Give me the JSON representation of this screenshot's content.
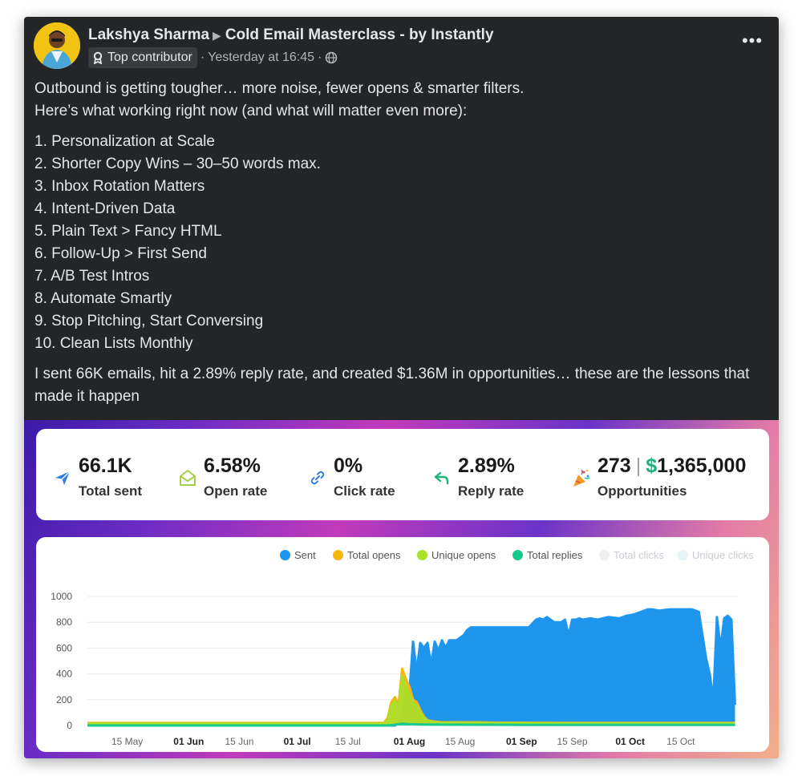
{
  "post": {
    "author": "Lakshya Sharma",
    "group": "Cold Email Masterclass - by Instantly",
    "badge": "Top contributor",
    "time": "Yesterday at 16:45",
    "intro_line1": "Outbound is getting tougher… more noise, fewer opens & smarter filters.",
    "intro_line2": "Here’s what working right now (and what will matter even more):",
    "list": [
      "1. Personalization at Scale",
      "2. Shorter Copy Wins – 30–50 words max.",
      "3. Inbox Rotation Matters",
      "4. Intent-Driven Data",
      "5. Plain Text > Fancy HTML",
      "6. Follow-Up > First Send",
      "7. A/B Test Intros",
      "8. Automate Smartly",
      "9. Stop Pitching, Start Conversing",
      "10. Clean Lists Monthly"
    ],
    "closing": "I sent 66K emails, hit a 2.89% reply rate, and created $1.36M in opportunities… these are the lessons that made it happen"
  },
  "stats": {
    "sent": {
      "value": "66.1K",
      "label": "Total sent",
      "icon": "paper-plane-icon",
      "color": "#2f7de1"
    },
    "open": {
      "value": "6.58%",
      "label": "Open rate",
      "icon": "envelope-open-icon",
      "color": "#a6d04a"
    },
    "click": {
      "value": "0%",
      "label": "Click rate",
      "icon": "link-icon",
      "color": "#2f7de1"
    },
    "reply": {
      "value": "2.89%",
      "label": "Reply rate",
      "icon": "reply-arrow-icon",
      "color": "#22b37a"
    },
    "opps": {
      "count": "273",
      "sep": "|",
      "currency": "$",
      "money": "1,365,000",
      "label": "Opportunities",
      "icon": "party-popper-icon"
    }
  },
  "chart_data": {
    "type": "area",
    "x_ticks": [
      "15 May",
      "01 Jun",
      "15 Jun",
      "01 Jul",
      "15 Jul",
      "01 Aug",
      "15 Aug",
      "01 Sep",
      "15 Sep",
      "01 Oct",
      "15 Oct"
    ],
    "x_ticks_bold": [
      "01 Jun",
      "01 Jul",
      "01 Aug",
      "01 Sep",
      "01 Oct"
    ],
    "y_ticks": [
      "0",
      "200",
      "400",
      "600",
      "800",
      "1000"
    ],
    "ylim": [
      0,
      1000
    ],
    "grid": true,
    "legend_position": "top-right",
    "legend": [
      {
        "name": "Sent",
        "color": "#1e96ee",
        "active": true
      },
      {
        "name": "Total opens",
        "color": "#f5b70f",
        "active": true
      },
      {
        "name": "Unique opens",
        "color": "#a8e02a",
        "active": true
      },
      {
        "name": "Total replies",
        "color": "#16c98d",
        "active": true
      },
      {
        "name": "Total clicks",
        "color": "#eef0f2",
        "active": false
      },
      {
        "name": "Unique clicks",
        "color": "#e6f4fa",
        "active": false
      }
    ],
    "series": [
      {
        "name": "Sent",
        "x": [
          "2024-05-04",
          "2024-07-28",
          "2024-07-29",
          "2024-07-30",
          "2024-07-31",
          "2024-08-01",
          "2024-08-02",
          "2024-08-03",
          "2024-08-04",
          "2024-08-05",
          "2024-08-06",
          "2024-08-07",
          "2024-08-08",
          "2024-08-09",
          "2024-08-10",
          "2024-08-11",
          "2024-08-12",
          "2024-08-14",
          "2024-08-16",
          "2024-08-17",
          "2024-08-18",
          "2024-08-19",
          "2024-08-20",
          "2024-08-22",
          "2024-08-25",
          "2024-08-28",
          "2024-08-31",
          "2024-09-03",
          "2024-09-05",
          "2024-09-06",
          "2024-09-07",
          "2024-09-08",
          "2024-09-09",
          "2024-09-10",
          "2024-09-12",
          "2024-09-13",
          "2024-09-14",
          "2024-09-15",
          "2024-09-16",
          "2024-09-17",
          "2024-09-18",
          "2024-09-20",
          "2024-09-22",
          "2024-09-25",
          "2024-09-28",
          "2024-09-30",
          "2024-10-02",
          "2024-10-03",
          "2024-10-04",
          "2024-10-05",
          "2024-10-06",
          "2024-10-07",
          "2024-10-09",
          "2024-10-12",
          "2024-10-15",
          "2024-10-18",
          "2024-10-20",
          "2024-10-21",
          "2024-10-22",
          "2024-10-23",
          "2024-10-24",
          "2024-10-25",
          "2024-10-26",
          "2024-10-27",
          "2024-10-28",
          "2024-10-29",
          "2024-10-30"
        ],
        "values": [
          0,
          0,
          30,
          80,
          300,
          250,
          650,
          420,
          640,
          600,
          640,
          470,
          650,
          580,
          660,
          600,
          660,
          660,
          700,
          740,
          760,
          760,
          760,
          760,
          760,
          760,
          760,
          760,
          820,
          830,
          820,
          840,
          820,
          800,
          800,
          820,
          700,
          820,
          820,
          830,
          820,
          830,
          820,
          840,
          830,
          850,
          860,
          870,
          880,
          890,
          900,
          900,
          890,
          900,
          900,
          900,
          880,
          700,
          520,
          400,
          200,
          840,
          600,
          830,
          850,
          820,
          160
        ]
      },
      {
        "name": "Total opens",
        "x": [
          "2024-05-04",
          "2024-07-25",
          "2024-07-26",
          "2024-07-27",
          "2024-07-28",
          "2024-07-29",
          "2024-07-30",
          "2024-07-31",
          "2024-08-01",
          "2024-08-02",
          "2024-08-03",
          "2024-08-04",
          "2024-08-05",
          "2024-08-06",
          "2024-08-08",
          "2024-08-10",
          "2024-08-15",
          "2024-08-20",
          "2024-08-25",
          "2024-09-01",
          "2024-09-15",
          "2024-10-01",
          "2024-10-15",
          "2024-10-30"
        ],
        "values": [
          20,
          20,
          60,
          180,
          220,
          160,
          440,
          360,
          300,
          200,
          180,
          120,
          70,
          40,
          30,
          25,
          25,
          25,
          22,
          22,
          20,
          20,
          20,
          20
        ]
      },
      {
        "name": "Unique opens",
        "x": [
          "2024-05-04",
          "2024-07-25",
          "2024-07-26",
          "2024-07-27",
          "2024-07-28",
          "2024-07-29",
          "2024-07-30",
          "2024-07-31",
          "2024-08-01",
          "2024-08-02",
          "2024-08-03",
          "2024-08-04",
          "2024-08-05",
          "2024-08-06",
          "2024-08-08",
          "2024-08-10",
          "2024-08-15",
          "2024-08-20",
          "2024-08-25",
          "2024-09-01",
          "2024-09-15",
          "2024-10-01",
          "2024-10-15",
          "2024-10-30"
        ],
        "values": [
          15,
          15,
          40,
          150,
          190,
          130,
          380,
          300,
          240,
          170,
          150,
          100,
          60,
          35,
          25,
          20,
          20,
          20,
          18,
          18,
          16,
          16,
          16,
          16
        ]
      },
      {
        "name": "Total replies",
        "x": [
          "2024-05-04",
          "2024-07-26",
          "2024-07-28",
          "2024-07-30",
          "2024-08-01",
          "2024-08-04",
          "2024-08-10",
          "2024-09-01",
          "2024-10-01",
          "2024-10-30"
        ],
        "values": [
          0,
          0,
          6,
          14,
          10,
          8,
          6,
          5,
          5,
          5
        ]
      }
    ]
  }
}
